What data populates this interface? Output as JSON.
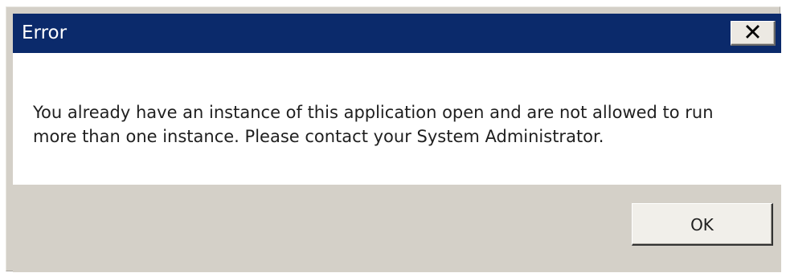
{
  "window": {
    "title": "Error",
    "close_label": "✕",
    "close_icon": "close-icon"
  },
  "content": {
    "message": "You already have an instance of this application open and are not allowed to run more than one instance. Please contact your System Administrator."
  },
  "buttons": {
    "ok_label": "OK"
  },
  "colors": {
    "titlebar": "#0b2a6b",
    "dialog_background": "#d4d0c8",
    "message_background": "#ffffff",
    "text": "#1f1f1f"
  }
}
